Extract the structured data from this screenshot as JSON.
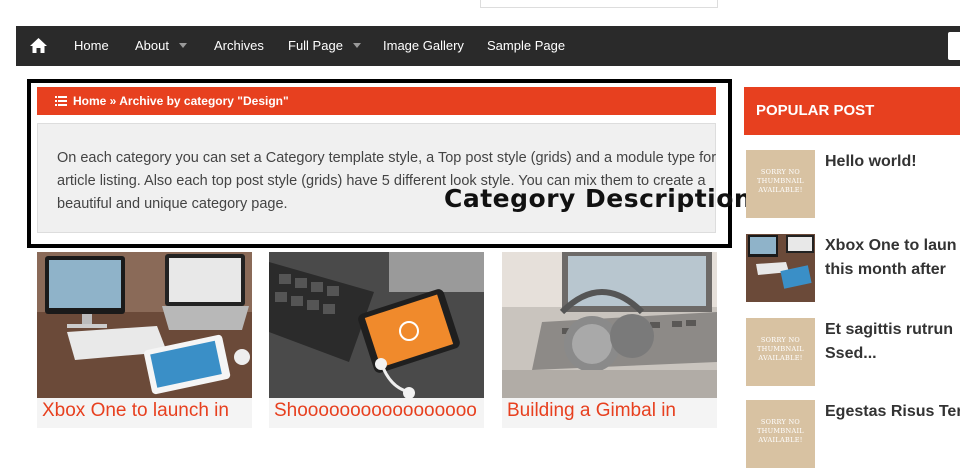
{
  "nav": {
    "home_icon": "home-icon",
    "items": [
      {
        "label": "Home",
        "has_caret": false
      },
      {
        "label": "About",
        "has_caret": true
      },
      {
        "label": "Archives",
        "has_caret": false
      },
      {
        "label": "Full Page",
        "has_caret": true
      },
      {
        "label": "Image Gallery",
        "has_caret": false
      },
      {
        "label": "Sample Page",
        "has_caret": false
      }
    ]
  },
  "breadcrumb": {
    "icon": "list-icon",
    "text": "Home » Archive by category \"Design\""
  },
  "category_description": "On each category you can set a Category template style, a Top post style (grids) and a module type for article listing. Also each top post style (grids) have 5 different look style. You can mix them to create a beautiful and unique category page.",
  "annotation": "Category Description",
  "posts": [
    {
      "title": "Xbox One to launch in"
    },
    {
      "title": "Shooooooooooooooooo"
    },
    {
      "title": "Building a Gimbal in"
    }
  ],
  "sidebar": {
    "heading": "POPULAR POST",
    "no_thumb_text": "SORRY NO THUMBNAIL AVAILABLE!",
    "items": [
      {
        "title": "Hello world!",
        "thumb": "no-thumbnail"
      },
      {
        "title": "Xbox One to laun",
        "title2": "this month after",
        "thumb": "image"
      },
      {
        "title": "Et sagittis rutrun",
        "title2": "Ssed...",
        "thumb": "no-thumbnail"
      },
      {
        "title": "Egestas Risus Ter",
        "thumb": "no-thumbnail"
      }
    ]
  },
  "colors": {
    "accent": "#e7401f",
    "nav_bg": "#2a2a2a",
    "desc_bg": "#f0f0f0",
    "no_thumb_bg": "#d8c2a2"
  }
}
